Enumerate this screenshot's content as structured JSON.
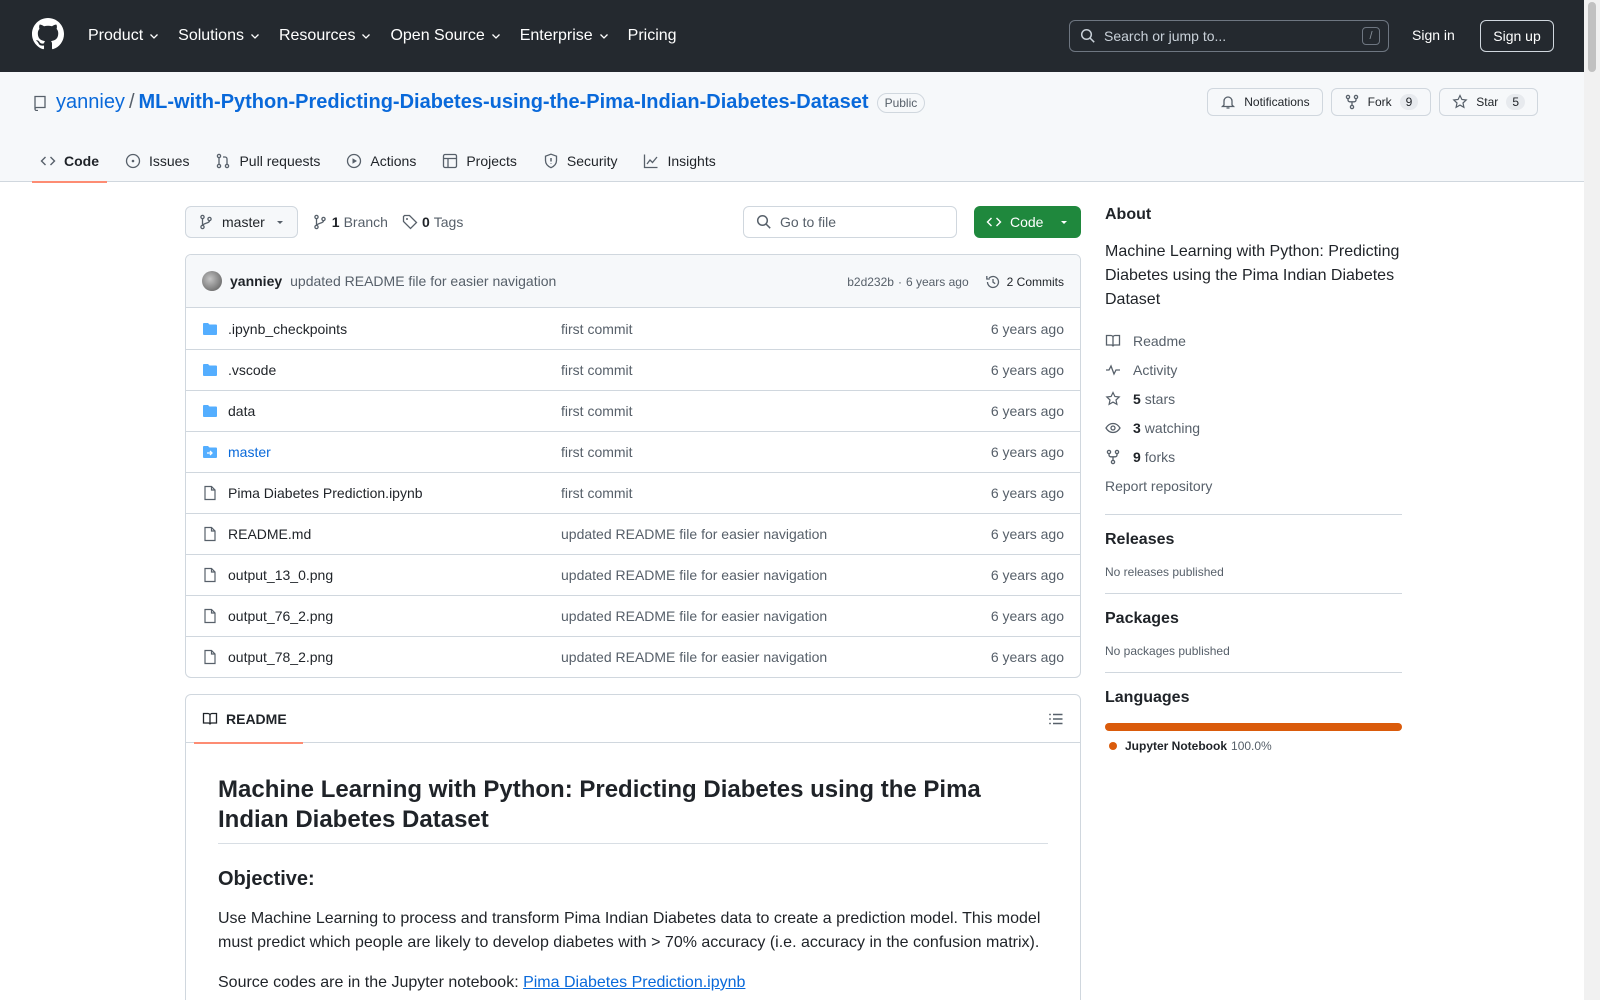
{
  "header": {
    "nav": [
      "Product",
      "Solutions",
      "Resources",
      "Open Source",
      "Enterprise",
      "Pricing"
    ],
    "search_placeholder": "Search or jump to...",
    "search_shortcut": "/",
    "signin": "Sign in",
    "signup": "Sign up"
  },
  "repo": {
    "owner": "yanniey",
    "separator": "/",
    "name": "ML-with-Python-Predicting-Diabetes-using-the-Pima-Indian-Diabetes-Dataset",
    "visibility": "Public",
    "notifications_label": "Notifications",
    "fork_label": "Fork",
    "fork_count": "9",
    "star_label": "Star",
    "star_count": "5"
  },
  "tabs": [
    "Code",
    "Issues",
    "Pull requests",
    "Actions",
    "Projects",
    "Security",
    "Insights"
  ],
  "toolbar": {
    "branch": "master",
    "branch_count": "1",
    "branch_label": "Branch",
    "tag_count": "0",
    "tag_label": "Tags",
    "goto_placeholder": "Go to file",
    "code_label": "Code"
  },
  "commit": {
    "author": "yanniey",
    "message": "updated README file for easier navigation",
    "hash": "b2d232b",
    "dot": "·",
    "age": "6 years ago",
    "commits": "2 Commits"
  },
  "files": [
    {
      "type": "folder",
      "name": ".ipynb_checkpoints",
      "message": "first commit",
      "date": "6 years ago"
    },
    {
      "type": "folder",
      "name": ".vscode",
      "message": "first commit",
      "date": "6 years ago"
    },
    {
      "type": "folder",
      "name": "data",
      "message": "first commit",
      "date": "6 years ago"
    },
    {
      "type": "submodule",
      "name": "master",
      "message": "first commit",
      "date": "6 years ago"
    },
    {
      "type": "file",
      "name": "Pima Diabetes Prediction.ipynb",
      "message": "first commit",
      "date": "6 years ago"
    },
    {
      "type": "file",
      "name": "README.md",
      "message": "updated README file for easier navigation",
      "date": "6 years ago"
    },
    {
      "type": "file",
      "name": "output_13_0.png",
      "message": "updated README file for easier navigation",
      "date": "6 years ago"
    },
    {
      "type": "file",
      "name": "output_76_2.png",
      "message": "updated README file for easier navigation",
      "date": "6 years ago"
    },
    {
      "type": "file",
      "name": "output_78_2.png",
      "message": "updated README file for easier navigation",
      "date": "6 years ago"
    }
  ],
  "readme": {
    "tab": "README",
    "title": "Machine Learning with Python: Predicting Diabetes using the Pima Indian Diabetes Dataset",
    "objective_heading": "Objective:",
    "objective_text": "Use Machine Learning to process and transform Pima Indian Diabetes data to create a prediction model. This model must predict which people are likely to develop diabetes with > 70% accuracy (i.e. accuracy in the confusion matrix).",
    "source_prefix": "Source codes are in the Jupyter notebook: ",
    "source_link": "Pima Diabetes Prediction.ipynb"
  },
  "sidebar": {
    "about_heading": "About",
    "about_desc": "Machine Learning with Python: Predicting Diabetes using the Pima Indian Diabetes Dataset",
    "readme": "Readme",
    "activity": "Activity",
    "stars_count": "5",
    "stars_label": "stars",
    "watching_count": "3",
    "watching_label": "watching",
    "forks_count": "9",
    "forks_label": "forks",
    "report": "Report repository",
    "releases_heading": "Releases",
    "releases_text": "No releases published",
    "packages_heading": "Packages",
    "packages_text": "No packages published",
    "languages_heading": "Languages",
    "language_name": "Jupyter Notebook",
    "language_pct": "100.0%",
    "language_color": "#DA5B0B"
  }
}
